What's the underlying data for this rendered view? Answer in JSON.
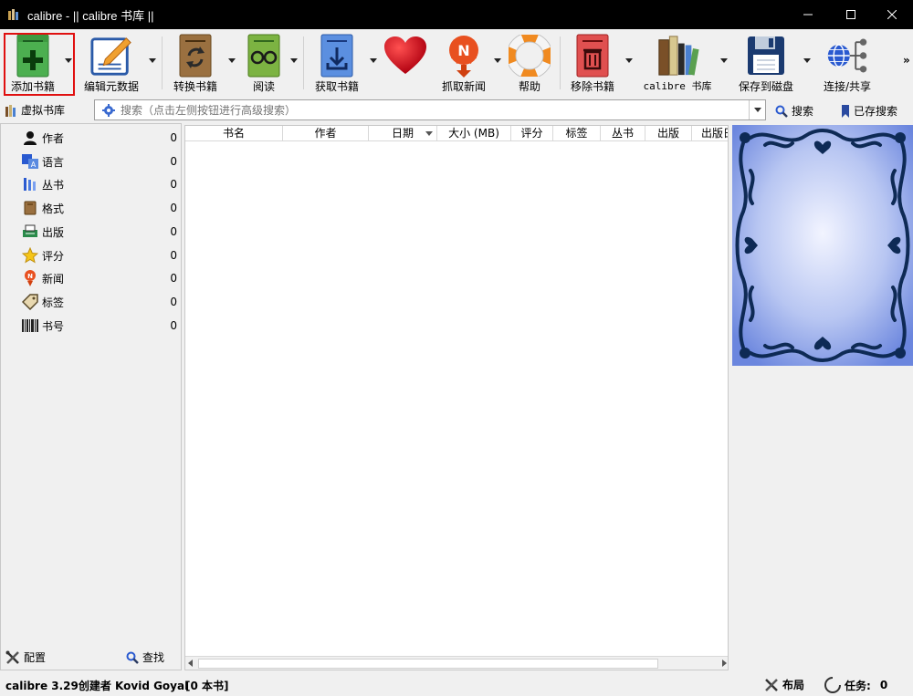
{
  "window": {
    "title": "calibre - || calibre 书库 ||"
  },
  "toolbar": {
    "add_books": "添加书籍",
    "edit_metadata": "编辑元数据",
    "convert_books": "转换书籍",
    "view": "阅读",
    "get_books": "获取书籍",
    "fetch_news": "抓取新闻",
    "help": "帮助",
    "remove_books": "移除书籍",
    "library": "calibre 书库",
    "save_to_disk": "保存到磁盘",
    "connect_share": "连接/共享",
    "more": "»"
  },
  "searchbar": {
    "virtual_library": "虚拟书库",
    "placeholder": "搜索（点击左侧按钮进行高级搜索）",
    "search_button": "搜索",
    "saved_searches": "已存搜索"
  },
  "tag_browser": {
    "items": [
      {
        "label": "作者",
        "count": "0",
        "icon": "user-icon"
      },
      {
        "label": "语言",
        "count": "0",
        "icon": "language-icon"
      },
      {
        "label": "丛书",
        "count": "0",
        "icon": "series-icon"
      },
      {
        "label": "格式",
        "count": "0",
        "icon": "format-icon"
      },
      {
        "label": "出版",
        "count": "0",
        "icon": "publisher-icon"
      },
      {
        "label": "评分",
        "count": "0",
        "icon": "star-icon"
      },
      {
        "label": "新闻",
        "count": "0",
        "icon": "news-icon"
      },
      {
        "label": "标签",
        "count": "0",
        "icon": "tag-icon"
      },
      {
        "label": "书号",
        "count": "0",
        "icon": "barcode-icon"
      }
    ],
    "configure": "配置",
    "find": "查找"
  },
  "book_list": {
    "columns": [
      "书名",
      "作者",
      "日期",
      "大小 (MB)",
      "评分",
      "标签",
      "丛书",
      "出版",
      "出版日"
    ]
  },
  "statusbar": {
    "version": "calibre 3.29创建者 Kovid Goyal",
    "book_count": "[0 本书]",
    "layout": "布局",
    "jobs_label": "任务:",
    "jobs_count": "0"
  },
  "colors": {
    "titlebar": "#000000",
    "highlight": "#e01010",
    "cover_gradient_center": "#f2f4ff",
    "cover_gradient_edge": "#6b86de",
    "cover_ornament": "#0e2a55"
  }
}
